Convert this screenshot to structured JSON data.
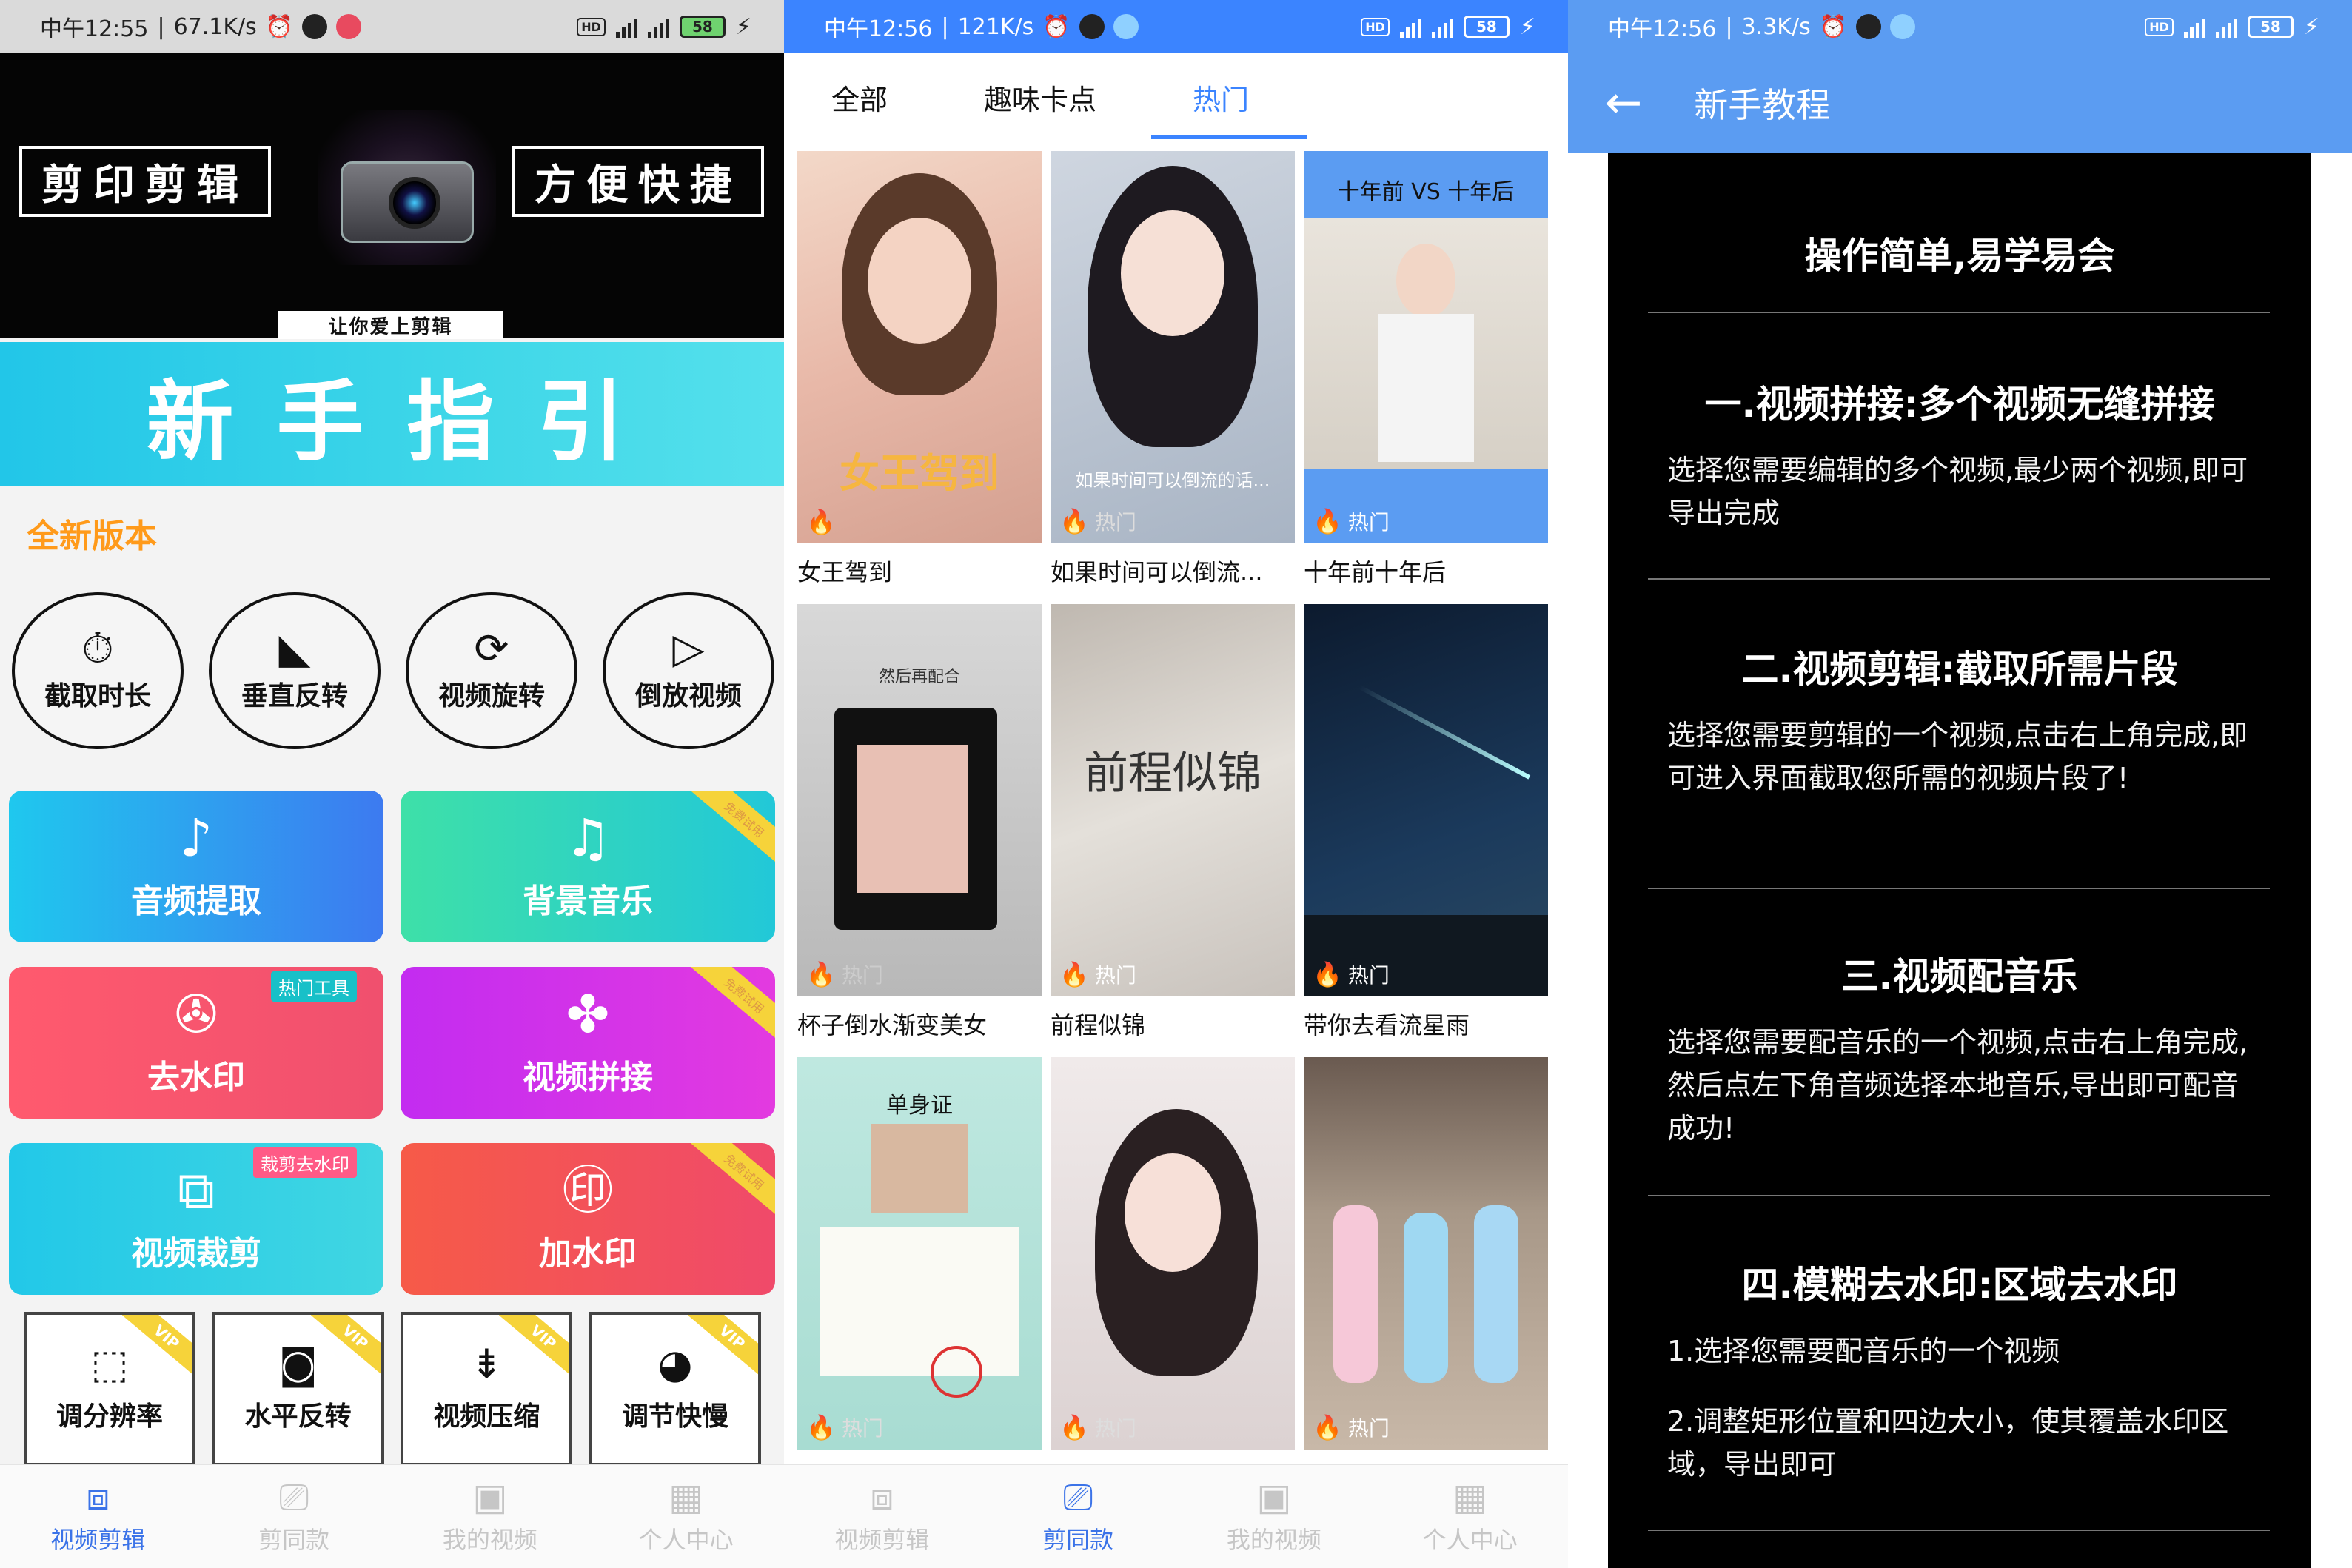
{
  "panel1": {
    "status": {
      "time": "中午12:55",
      "speed": "67.1K/s",
      "battery": "58"
    },
    "banner": {
      "left": "剪印剪辑",
      "right": "方便快捷",
      "sub": "让你爱上剪辑"
    },
    "guide": "新手指引",
    "new_version": "全新版本",
    "circle_tools": [
      {
        "label": "截取时长",
        "icon": "stopwatch-icon"
      },
      {
        "label": "垂直反转",
        "icon": "flip-icon"
      },
      {
        "label": "视频旋转",
        "icon": "rotate-icon"
      },
      {
        "label": "倒放视频",
        "icon": "reverse-play-icon"
      }
    ],
    "tiles": [
      {
        "label": "音频提取",
        "icon": "music-note-icon",
        "tag": "",
        "ribbon": ""
      },
      {
        "label": "背景音乐",
        "icon": "music-notes-icon",
        "tag": "",
        "ribbon": "免费试用"
      },
      {
        "label": "去水印",
        "icon": "film-reel-icon",
        "tag": "热门工具",
        "ribbon": ""
      },
      {
        "label": "视频拼接",
        "icon": "clover-icon",
        "tag": "",
        "ribbon": "免费试用"
      },
      {
        "label": "视频裁剪",
        "icon": "crop-icon",
        "tag": "裁剪去水印",
        "ribbon": ""
      },
      {
        "label": "加水印",
        "icon": "stamp-icon",
        "tag": "",
        "ribbon": "免费试用"
      }
    ],
    "square_tools": [
      {
        "label": "调分辨率",
        "icon": "resolution-icon",
        "vip": "VIP"
      },
      {
        "label": "水平反转",
        "icon": "camera-flip-icon",
        "vip": "VIP"
      },
      {
        "label": "视频压缩",
        "icon": "compress-icon",
        "vip": "VIP"
      },
      {
        "label": "调节快慢",
        "icon": "speed-gauge-icon",
        "vip": "VIP"
      }
    ],
    "nav": [
      "视频剪辑",
      "剪同款",
      "我的视频",
      "个人中心"
    ]
  },
  "panel2": {
    "status": {
      "time": "中午12:56",
      "speed": "121K/s",
      "battery": "58"
    },
    "tabs": [
      "全部",
      "趣味卡点",
      "热门"
    ],
    "hot_label": "热门",
    "cards": [
      {
        "title": "女王驾到",
        "overlay": "女王驾到"
      },
      {
        "title": "如果时间可以倒流...",
        "overlay": "如果时间可以倒流的话..."
      },
      {
        "title": "十年前十年后",
        "overlay": "十年前 VS 十年后"
      },
      {
        "title": "杯子倒水渐变美女",
        "overlay": "然后再配合"
      },
      {
        "title": "前程似锦",
        "overlay": "前程似锦"
      },
      {
        "title": "带你去看流星雨",
        "overlay": ""
      },
      {
        "title": "",
        "overlay": "单身证"
      },
      {
        "title": "",
        "overlay": ""
      },
      {
        "title": "",
        "overlay": ""
      }
    ],
    "nav": [
      "视频剪辑",
      "剪同款",
      "我的视频",
      "个人中心"
    ]
  },
  "panel3": {
    "status": {
      "time": "中午12:56",
      "speed": "3.3K/s",
      "battery": "58"
    },
    "title": "新手教程",
    "heading": "操作简单,易学易会",
    "sections": [
      {
        "title": "一.视频拼接:多个视频无缝拼接",
        "body": "选择您需要编辑的多个视频,最少两个视频,即可导出完成"
      },
      {
        "title": "二.视频剪辑:截取所需片段",
        "body": "选择您需要剪辑的一个视频,点击右上角完成,即可进入界面截取您所需的视频片段了!"
      },
      {
        "title": "三.视频配音乐",
        "body": "选择您需要配音乐的一个视频,点击右上角完成,然后点左下角音频选择本地音乐,导出即可配音成功!"
      },
      {
        "title": "四.模糊去水印:区域去水印",
        "body": "1.选择您需要配音乐的一个视频",
        "body2": "2.调整矩形位置和四边大小，使其覆盖水印区域，导出即可"
      }
    ]
  }
}
